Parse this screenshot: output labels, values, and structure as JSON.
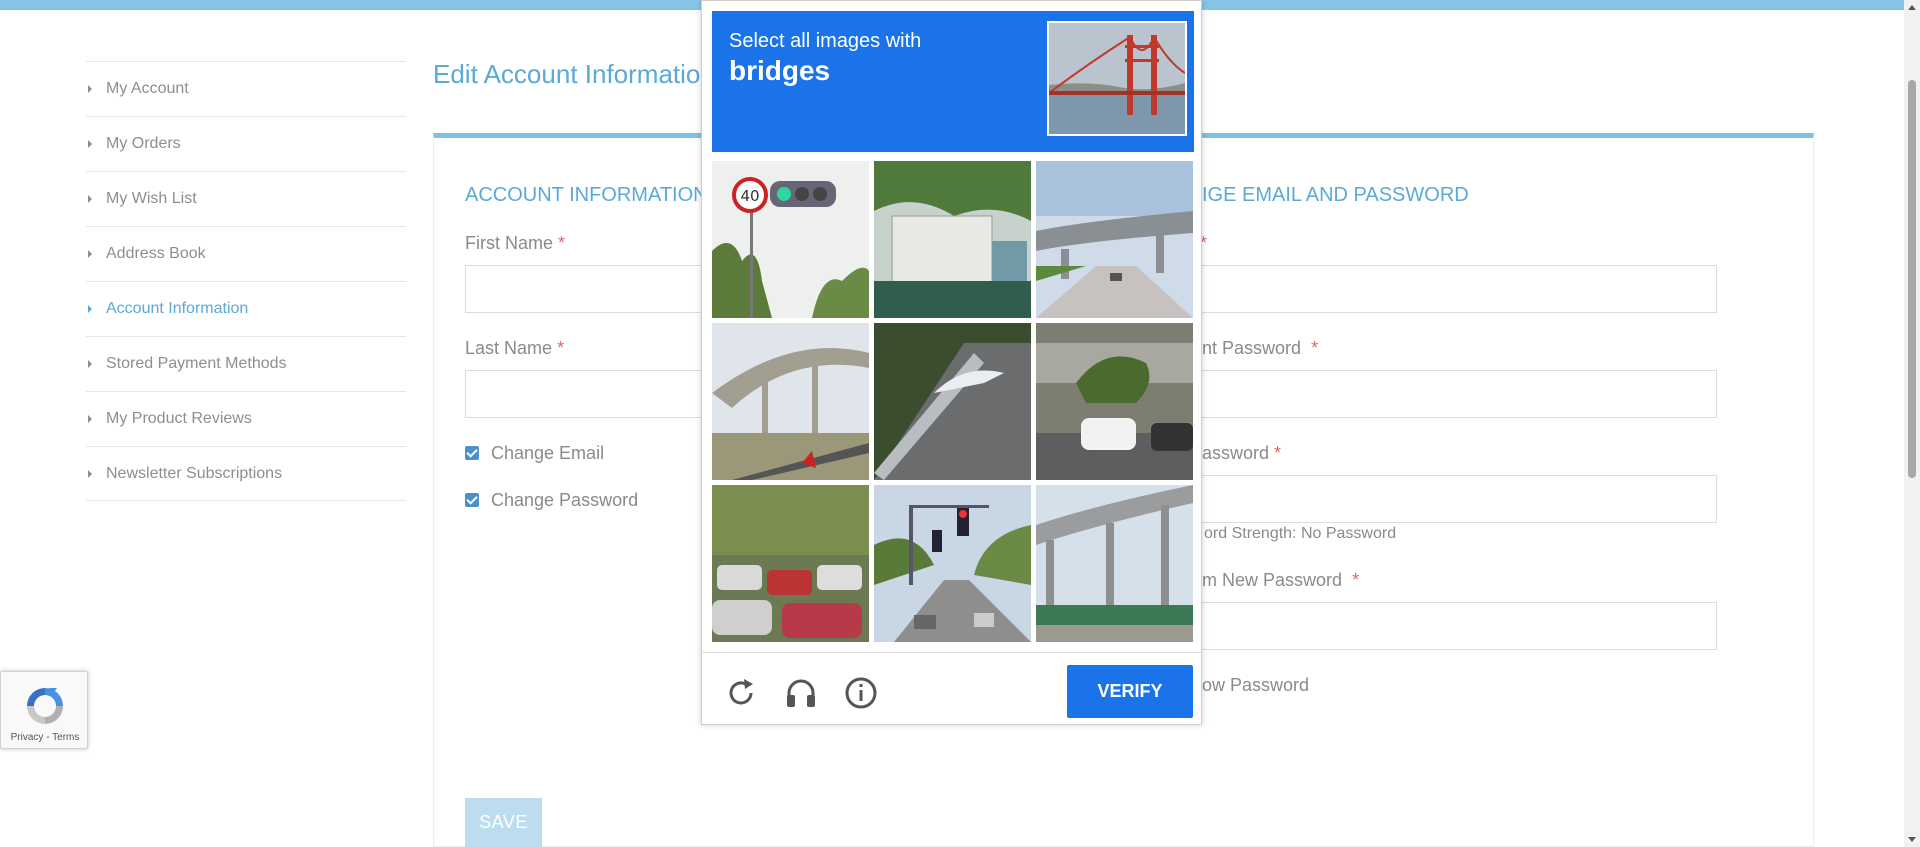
{
  "sidebar": {
    "items": [
      {
        "label": "My Account"
      },
      {
        "label": "My Orders"
      },
      {
        "label": "My Wish List"
      },
      {
        "label": "Address Book"
      },
      {
        "label": "Account Information"
      },
      {
        "label": "Stored Payment Methods"
      },
      {
        "label": "My Product Reviews"
      },
      {
        "label": "Newsletter Subscriptions"
      }
    ],
    "active_item": "Account Information"
  },
  "main": {
    "page_title": "Edit Account Information",
    "account_section": {
      "heading": "ACCOUNT INFORMATION",
      "first_name_label": "First Name",
      "last_name_label": "Last Name",
      "change_email_label": "Change Email",
      "change_email_checked": true,
      "change_password_label": "Change Password",
      "change_password_checked": true
    },
    "email_password_section": {
      "heading": "CHANGE EMAIL AND PASSWORD",
      "heading_visible": "IGE EMAIL AND PASSWORD",
      "email_label_visible": "",
      "current_password_label_visible": "nt Password",
      "new_password_label_visible": "assword",
      "password_strength_visible": "ord Strength: No Password",
      "confirm_password_label_visible": "m New Password",
      "show_password_visible": "ow Password"
    },
    "required_marker": "*",
    "save_label": "SAVE"
  },
  "captcha": {
    "prompt_line1": "Select all images with",
    "prompt_target": "bridges",
    "verify_label": "VERIFY",
    "footer_icons": [
      "reload-icon",
      "audio-headphones-icon",
      "info-icon"
    ],
    "tiles": [
      {
        "name": "traffic-sign-40-tile"
      },
      {
        "name": "truck-tile"
      },
      {
        "name": "highway-overpass-tile"
      },
      {
        "name": "curved-overpass-tile"
      },
      {
        "name": "guardrail-road-tile"
      },
      {
        "name": "parked-car-tile"
      },
      {
        "name": "parking-lot-tile"
      },
      {
        "name": "traffic-light-tile"
      },
      {
        "name": "elevated-highway-tile"
      }
    ],
    "accent": "#1a73e8"
  },
  "recaptcha_badge": {
    "links": "Privacy - Terms"
  },
  "colors": {
    "link_blue": "#5aa9d6",
    "top_bar": "#87c5e6",
    "required": "#e06666"
  }
}
